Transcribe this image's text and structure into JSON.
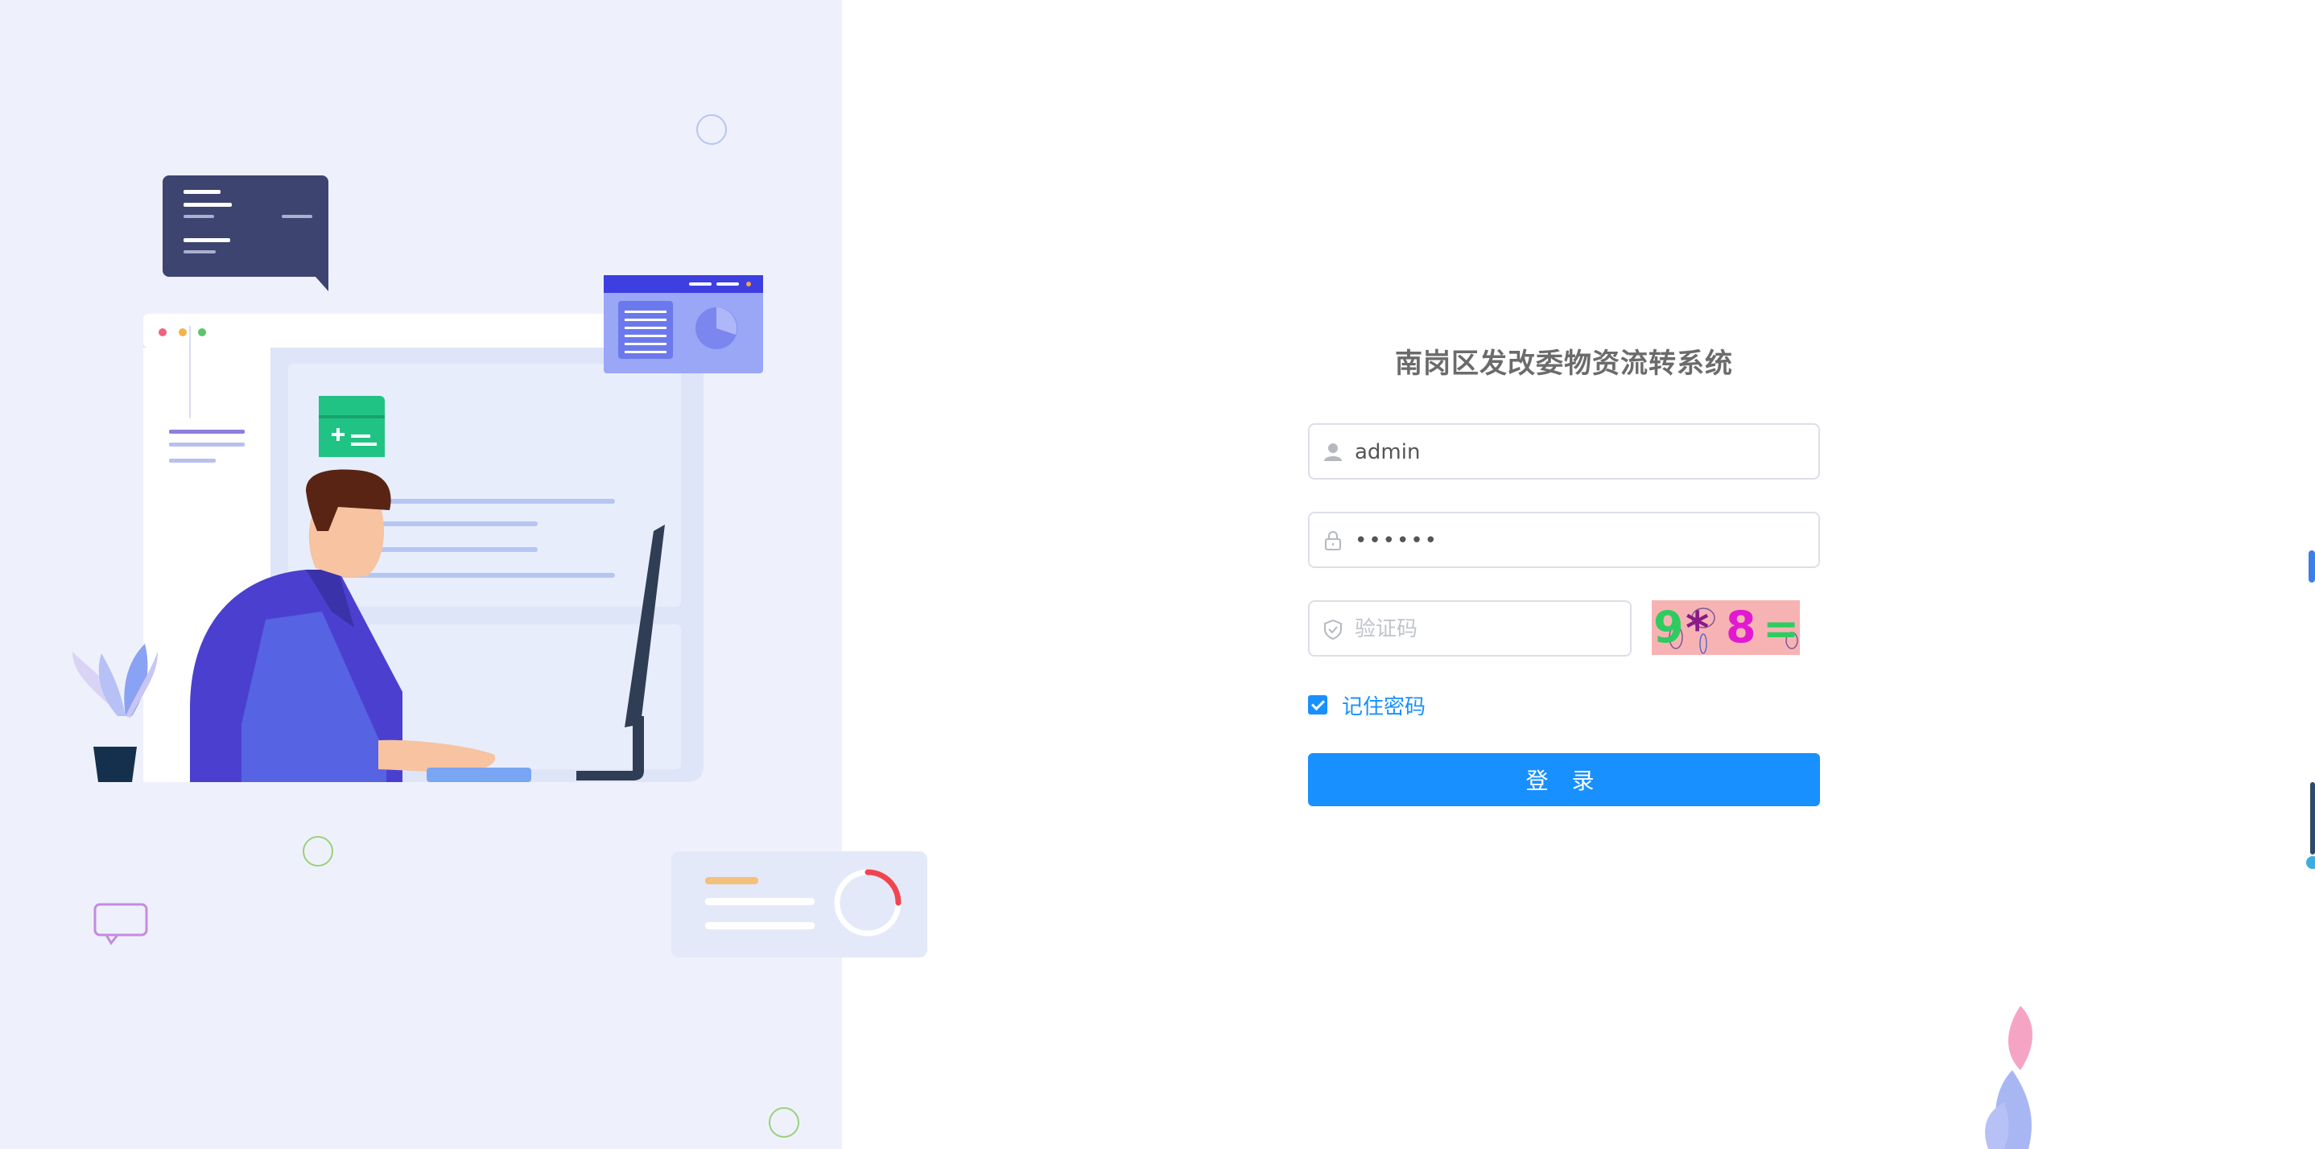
{
  "login": {
    "title": "南岗区发改委物资流转系统",
    "username": {
      "value": "admin",
      "icon": "user-icon"
    },
    "password": {
      "value": "••••••",
      "icon": "lock-icon"
    },
    "captcha": {
      "placeholder": "验证码",
      "icon": "shield-check-icon",
      "image_text": "9* 8 ="
    },
    "remember": {
      "label": "记住密码",
      "checked": true
    },
    "submit_label": "登 录"
  },
  "colors": {
    "primary": "#1890ff",
    "left_panel_bg": "#eef1fb",
    "captcha_bg": "#f7b3b3",
    "title_text": "#6b6b6b"
  }
}
